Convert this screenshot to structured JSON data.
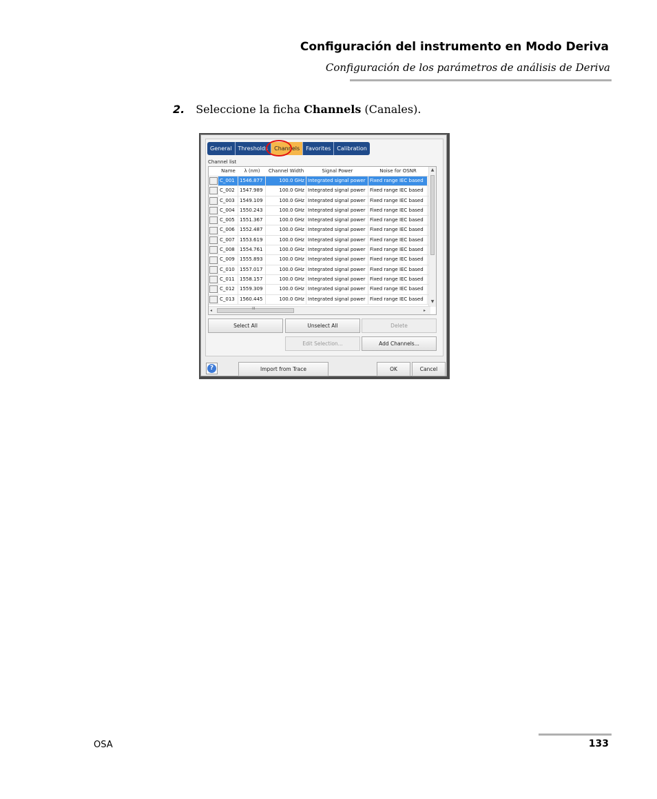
{
  "header": {
    "title": "Configuración del instrumento en Modo Deriva",
    "subtitle": "Configuración de los parámetros de análisis de Deriva"
  },
  "step": {
    "number": "2.",
    "text_before": "Seleccione la ficha ",
    "bold": "Channels",
    "text_after": " (Canales)."
  },
  "dialog": {
    "tabs": [
      "General",
      "Thresholds",
      "Channels",
      "Favorites",
      "Calibration"
    ],
    "active_tab": "Channels",
    "channel_list_label": "Channel list",
    "columns": [
      "Name",
      "λ (nm)",
      "Channel Width",
      "Signal Power",
      "Noise for OSNR"
    ],
    "rows": [
      {
        "name": "C_001",
        "wl": "1546.877",
        "width": "100.0 GHz",
        "power": "Integrated signal power",
        "noise": "Fixed range IEC based"
      },
      {
        "name": "C_002",
        "wl": "1547.989",
        "width": "100.0 GHz",
        "power": "Integrated signal power",
        "noise": "Fixed range IEC based"
      },
      {
        "name": "C_003",
        "wl": "1549.109",
        "width": "100.0 GHz",
        "power": "Integrated signal power",
        "noise": "Fixed range IEC based"
      },
      {
        "name": "C_004",
        "wl": "1550.243",
        "width": "100.0 GHz",
        "power": "Integrated signal power",
        "noise": "Fixed range IEC based"
      },
      {
        "name": "C_005",
        "wl": "1551.367",
        "width": "100.0 GHz",
        "power": "Integrated signal power",
        "noise": "Fixed range IEC based"
      },
      {
        "name": "C_006",
        "wl": "1552.487",
        "width": "100.0 GHz",
        "power": "Integrated signal power",
        "noise": "Fixed range IEC based"
      },
      {
        "name": "C_007",
        "wl": "1553.619",
        "width": "100.0 GHz",
        "power": "Integrated signal power",
        "noise": "Fixed range IEC based"
      },
      {
        "name": "C_008",
        "wl": "1554.761",
        "width": "100.0 GHz",
        "power": "Integrated signal power",
        "noise": "Fixed range IEC based"
      },
      {
        "name": "C_009",
        "wl": "1555.893",
        "width": "100.0 GHz",
        "power": "Integrated signal power",
        "noise": "Fixed range IEC based"
      },
      {
        "name": "C_010",
        "wl": "1557.017",
        "width": "100.0 GHz",
        "power": "Integrated signal power",
        "noise": "Fixed range IEC based"
      },
      {
        "name": "C_011",
        "wl": "1558.157",
        "width": "100.0 GHz",
        "power": "Integrated signal power",
        "noise": "Fixed range IEC based"
      },
      {
        "name": "C_012",
        "wl": "1559.309",
        "width": "100.0 GHz",
        "power": "Integrated signal power",
        "noise": "Fixed range IEC based"
      },
      {
        "name": "C_013",
        "wl": "1560.445",
        "width": "100.0 GHz",
        "power": "Integrated signal power",
        "noise": "Fixed range IEC based"
      }
    ],
    "selected_row": "C_001",
    "hscroll_mark": "III",
    "buttons": {
      "select_all": "Select All",
      "unselect_all": "Unselect All",
      "delete": "Delete",
      "edit_selection": "Edit Selection...",
      "add_channels": "Add Channels...",
      "import_from_trace": "Import from Trace",
      "ok": "OK",
      "cancel": "Cancel",
      "help": "?"
    },
    "highlight_color": "#e01010",
    "tab_color": "#1f4a8a",
    "active_tab_color": "#f6b64a",
    "selection_color": "#3a8ee6"
  },
  "footer": {
    "left": "OSA",
    "page_number": "133"
  }
}
